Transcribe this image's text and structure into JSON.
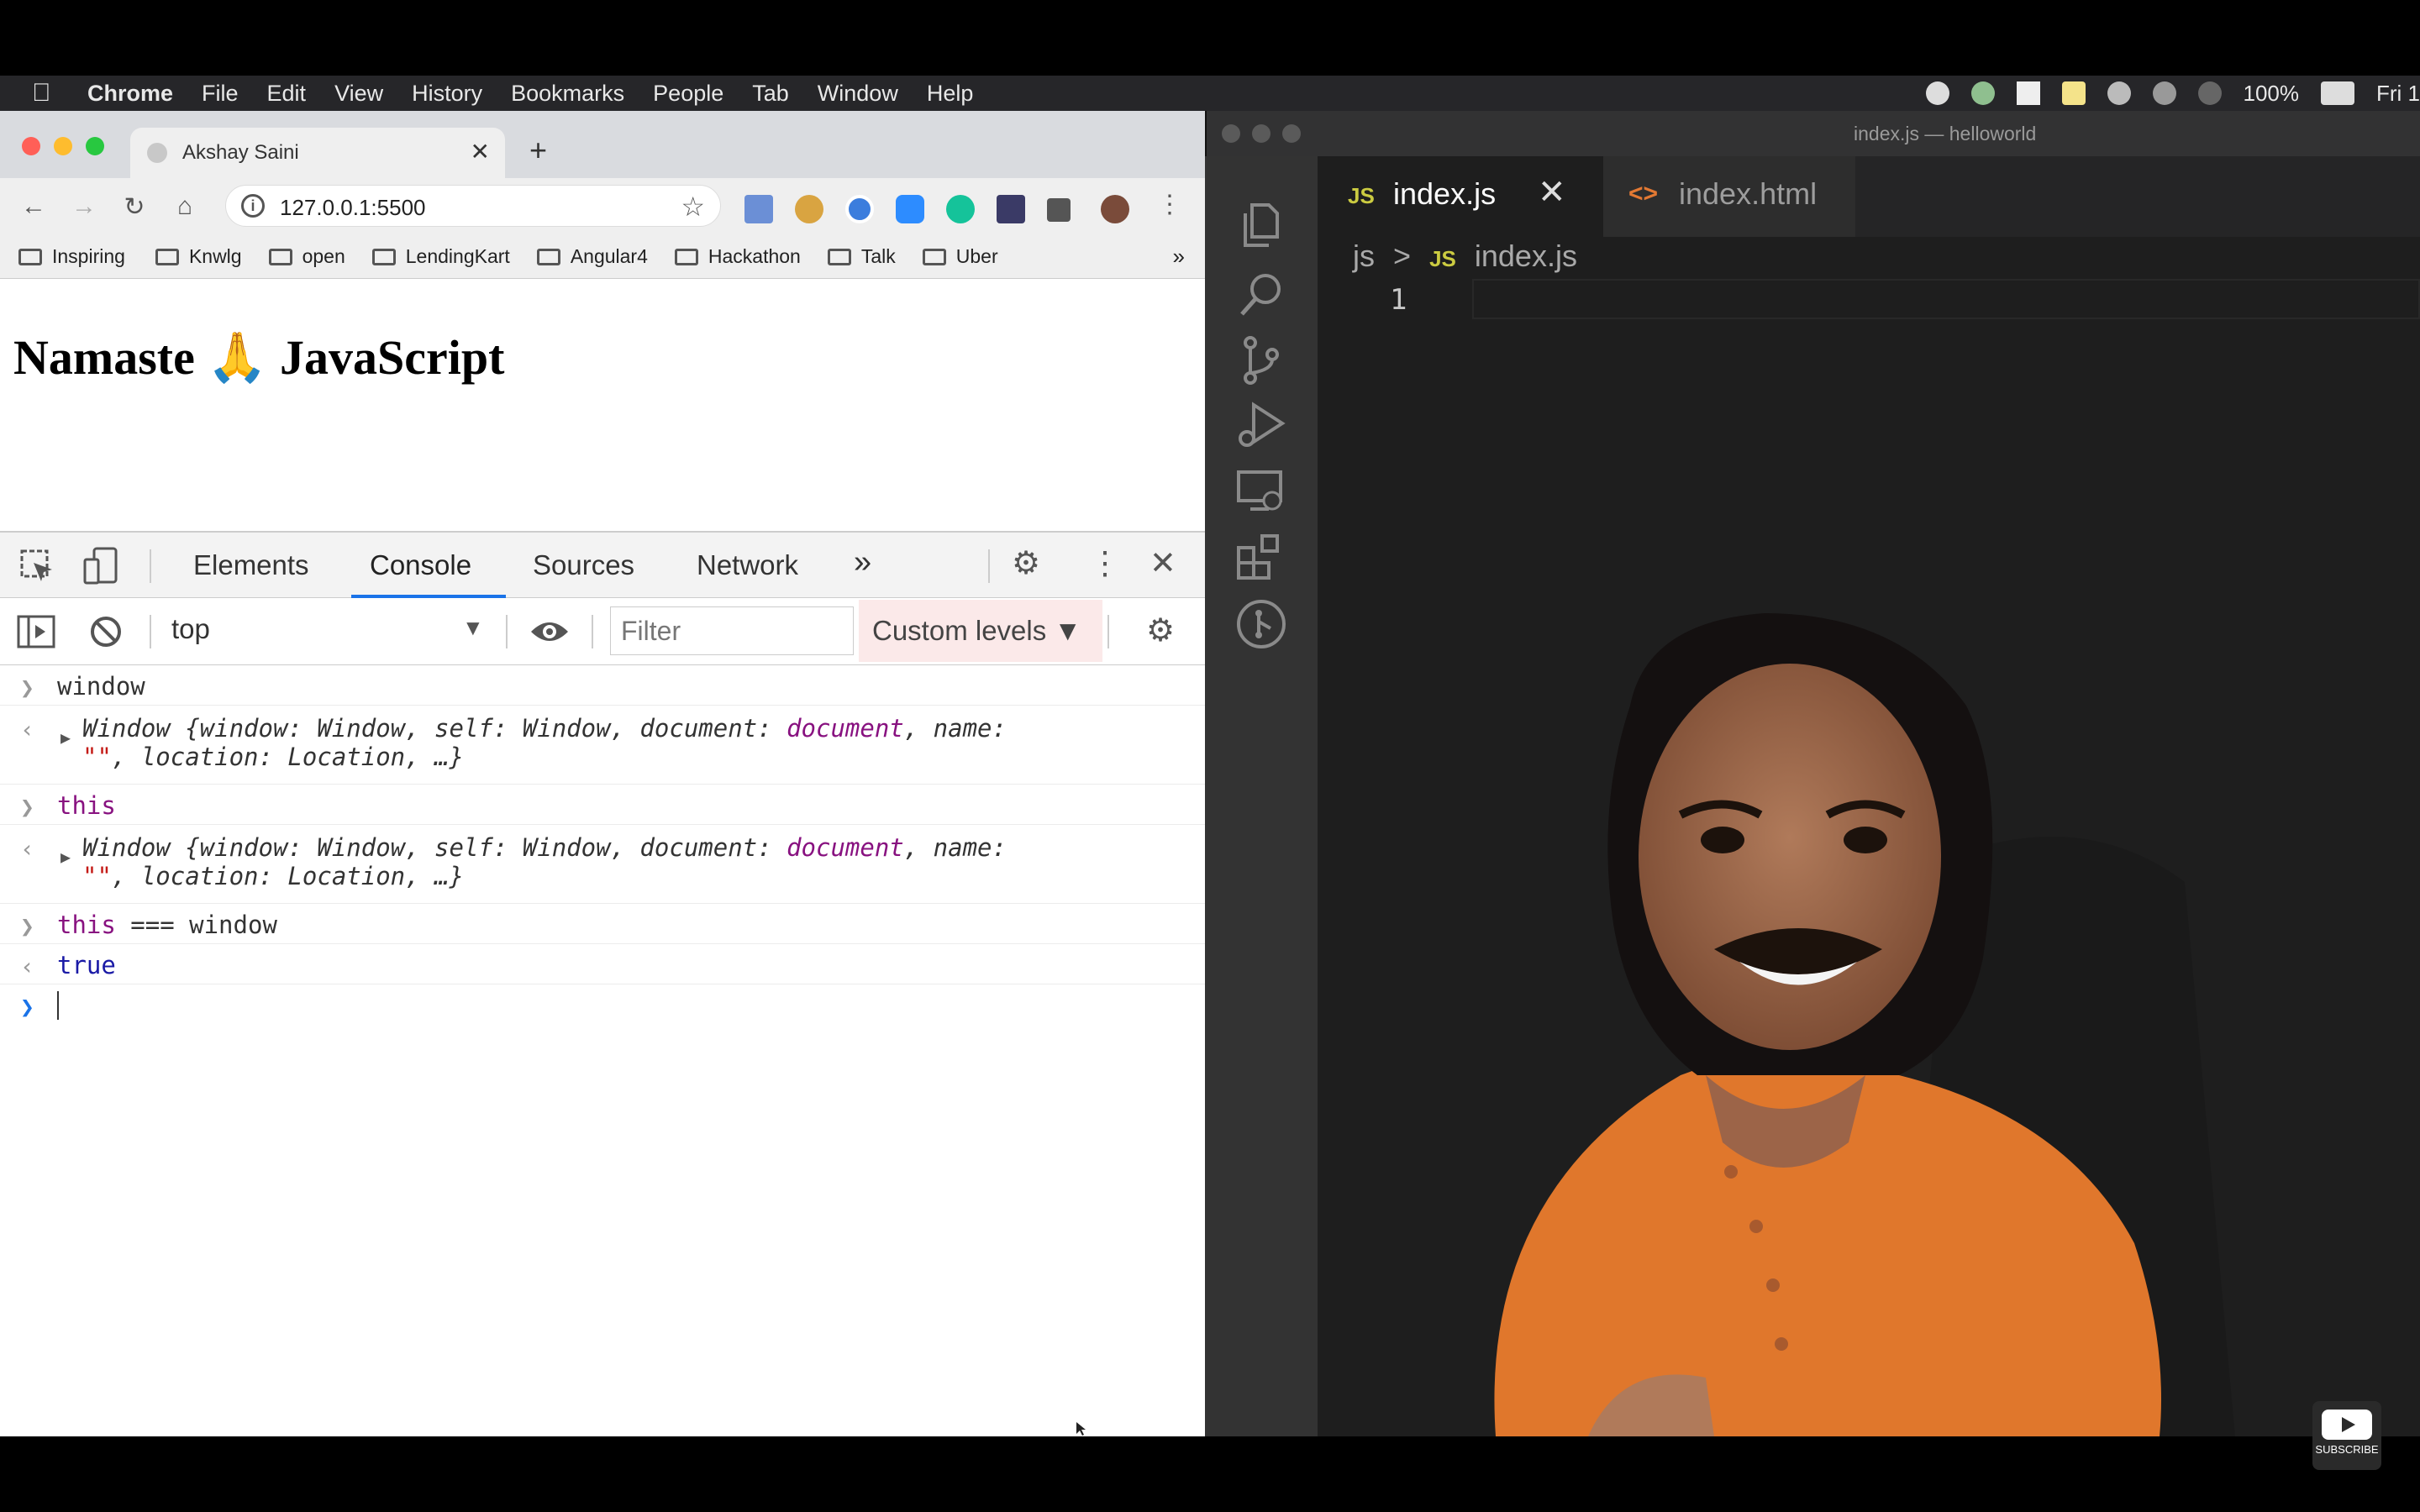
{
  "menubar": {
    "items": [
      "Chrome",
      "File",
      "Edit",
      "View",
      "History",
      "Bookmarks",
      "People",
      "Tab",
      "Window",
      "Help"
    ],
    "battery": "100%",
    "clock": "Fri 1"
  },
  "browser": {
    "tab_title": "Akshay Saini",
    "new_tab": "+",
    "tab_close": "✕",
    "url": "127.0.0.1:5500",
    "bookmarks": [
      "Inspiring",
      "Knwlg",
      "open",
      "LendingKart",
      "Angular4",
      "Hackathon",
      "Talk",
      "Uber"
    ],
    "bookmarks_more": "»",
    "page_heading": "Namaste 🙏 JavaScript"
  },
  "devtools": {
    "tabs": [
      "Elements",
      "Console",
      "Sources",
      "Network"
    ],
    "active_tab": "Console",
    "more_tabs": "»",
    "context": "top",
    "filter_placeholder": "Filter",
    "levels": "Custom levels ▼"
  },
  "console": {
    "entries": [
      {
        "input": "window"
      },
      {
        "output_line1": "Window {window: Window, self: Window, document: ",
        "doc": "document",
        "output_name": ", name:",
        "str": "\"\"",
        "output_line2": ", location: Location, …}"
      },
      {
        "input": "this"
      },
      {
        "output_line1": "Window {window: Window, self: Window, document: ",
        "doc": "document",
        "output_name": ", name:",
        "str": "\"\"",
        "output_line2": ", location: Location, …}"
      },
      {
        "input_kw": "this",
        "input_rest": " === window"
      },
      {
        "result": "true"
      }
    ]
  },
  "editor": {
    "window_title": "index.js — helloworld",
    "tabs": [
      {
        "badge": "JS",
        "label": "index.js",
        "close": "✕"
      },
      {
        "badge": "<>",
        "label": "index.html"
      }
    ],
    "breadcrumb": {
      "folder": "js",
      "sep": ">",
      "badge": "JS",
      "file": "index.js"
    },
    "line_number": "1"
  },
  "youtube": {
    "label": "SUBSCRIBE"
  },
  "colors": {
    "accent": "#1a73e8",
    "vscode_bg": "#1e1e1e",
    "shirt": "#e0772c"
  }
}
